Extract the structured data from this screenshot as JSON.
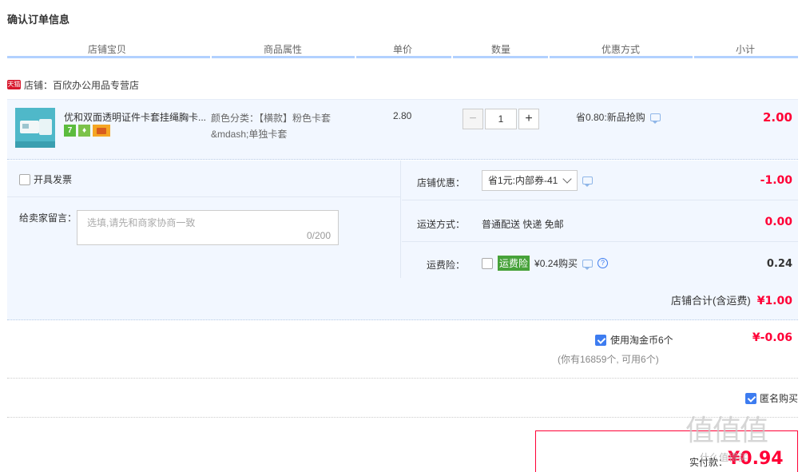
{
  "page_title": "确认订单信息",
  "columns": [
    "店铺宝贝",
    "商品属性",
    "单价",
    "数量",
    "优惠方式",
    "小计"
  ],
  "shop": {
    "badge": "天猫",
    "name": "店铺：百欣办公用品专营店"
  },
  "item": {
    "name": "优和双面透明证件卡套挂绳胸卡...",
    "service_icons": [
      "seven-day-return-icon",
      "guarantee-icon",
      "card-payment-icon"
    ],
    "attr_label": "颜色分类：",
    "attr_value": "【横款】粉色卡套&mdash;单独卡套",
    "price": "2.80",
    "quantity": "1",
    "minus": "−",
    "plus": "+",
    "promo": "省0.80:新品抢购",
    "subtotal": "2.00"
  },
  "options": {
    "invoice_label": "开具发票",
    "message_label": "给卖家留言：",
    "message_placeholder": "选填,请先和商家协商一致",
    "message_count": "0/200",
    "shop_discount_label": "店铺优惠：",
    "shop_discount_value": "省1元:内部券-41",
    "shop_discount_amount": "-1.00",
    "shipping_label": "运送方式：",
    "shipping_value": "普通配送 快递 免邮",
    "shipping_amount": "0.00",
    "insurance_label": "运费险：",
    "insurance_tag": "运费险",
    "insurance_price": "¥0.24购买",
    "insurance_amount": "0.24",
    "shop_total_label": "店铺合计(含运费)",
    "shop_total_amount": "¥1.00"
  },
  "coins": {
    "label": "使用淘金币6个",
    "amount": "¥-0.06",
    "note": "(你有16859个, 可用6个)"
  },
  "anonymous": {
    "label": "匿名购买"
  },
  "payment": {
    "label": "实付款：",
    "amount": "¥0.94"
  },
  "watermark": {
    "text": "值值值",
    "sub": "什么值得买"
  }
}
